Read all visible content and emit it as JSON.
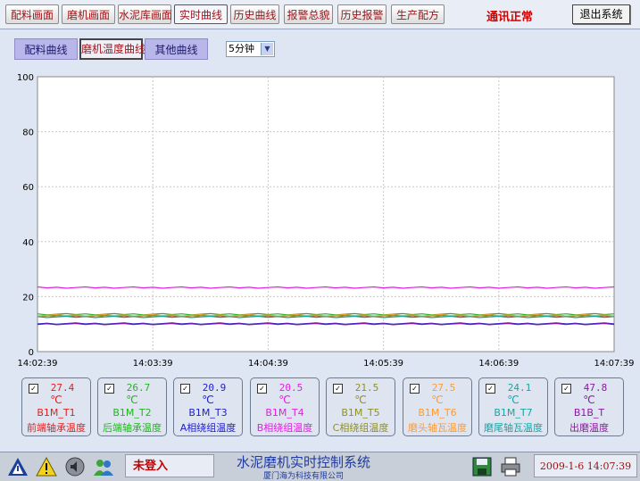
{
  "tabs": [
    {
      "label": "配料画面"
    },
    {
      "label": "磨机画面"
    },
    {
      "label": "水泥库画面"
    },
    {
      "label": "实时曲线"
    },
    {
      "label": "历史曲线"
    },
    {
      "label": "报警总貌"
    },
    {
      "label": "历史报警"
    },
    {
      "label": "生产配方"
    }
  ],
  "active_tab": "实时曲线",
  "comm_status": "通讯正常",
  "exit_label": "退出系统",
  "sub_buttons": [
    {
      "label": "配料曲线"
    },
    {
      "label": "磨机温度曲线"
    },
    {
      "label": "其他曲线"
    }
  ],
  "period": {
    "selected": "5分钟"
  },
  "chart_data": {
    "type": "line",
    "ylim": [
      0,
      100
    ],
    "yticks": [
      0,
      20,
      40,
      60,
      80,
      100
    ],
    "xticks": [
      "14:02:39",
      "14:03:39",
      "14:04:39",
      "14:05:39",
      "14:06:39",
      "14:07:39"
    ],
    "grid": true,
    "series": [
      {
        "name": "B1M_T1",
        "color": "#e02020",
        "y": 27.4,
        "plotted": 13.0
      },
      {
        "name": "B1M_T2",
        "color": "#22b422",
        "y": 26.7,
        "plotted": 13.6
      },
      {
        "name": "B1M_T3",
        "color": "#2020c8",
        "y": 20.9,
        "plotted": 10.2
      },
      {
        "name": "B1M_T4",
        "color": "#e020e0",
        "y": 20.5,
        "plotted": 23.3
      },
      {
        "name": "B1M_T5",
        "color": "#8f8f2a",
        "y": 21.5,
        "plotted": 12.8
      },
      {
        "name": "B1M_T6",
        "color": "#ff9a30",
        "y": 27.5,
        "plotted": 13.2
      },
      {
        "name": "B1M_T7",
        "color": "#1aa3a3",
        "y": 24.1,
        "plotted": 12.6
      },
      {
        "name": "B1B_T",
        "color": "#8b1aa0",
        "y": 47.8,
        "plotted": 10.0
      }
    ]
  },
  "cards": [
    {
      "value": "27.4",
      "unit": "℃",
      "code": "B1M_T1",
      "desc": "前端轴承温度",
      "color": "#e02020"
    },
    {
      "value": "26.7",
      "unit": "℃",
      "code": "B1M_T2",
      "desc": "后端轴承温度",
      "color": "#22b422"
    },
    {
      "value": "20.9",
      "unit": "℃",
      "code": "B1M_T3",
      "desc": "A相绕组温度",
      "color": "#2020c8"
    },
    {
      "value": "20.5",
      "unit": "℃",
      "code": "B1M_T4",
      "desc": "B相绕组温度",
      "color": "#e020e0"
    },
    {
      "value": "21.5",
      "unit": "℃",
      "code": "B1M_T5",
      "desc": "C相绕组温度",
      "color": "#8f8f2a"
    },
    {
      "value": "27.5",
      "unit": "℃",
      "code": "B1M_T6",
      "desc": "磨头轴瓦温度",
      "color": "#ff9a30"
    },
    {
      "value": "24.1",
      "unit": "℃",
      "code": "B1M_T7",
      "desc": "磨尾轴瓦温度",
      "color": "#1aa3a3"
    },
    {
      "value": "47.8",
      "unit": "℃",
      "code": "B1B_T",
      "desc": "出磨温度",
      "color": "#8b1aa0"
    }
  ],
  "status": {
    "login": "未登入",
    "title": "水泥磨机实时控制系统",
    "company": "厦门海为科技有限公司",
    "datetime": "2009-1-6 14:07:39"
  },
  "icons": [
    "warning-triangle-icon",
    "alert-icon",
    "speaker-icon",
    "users-icon",
    "save-icon",
    "printer-icon"
  ]
}
